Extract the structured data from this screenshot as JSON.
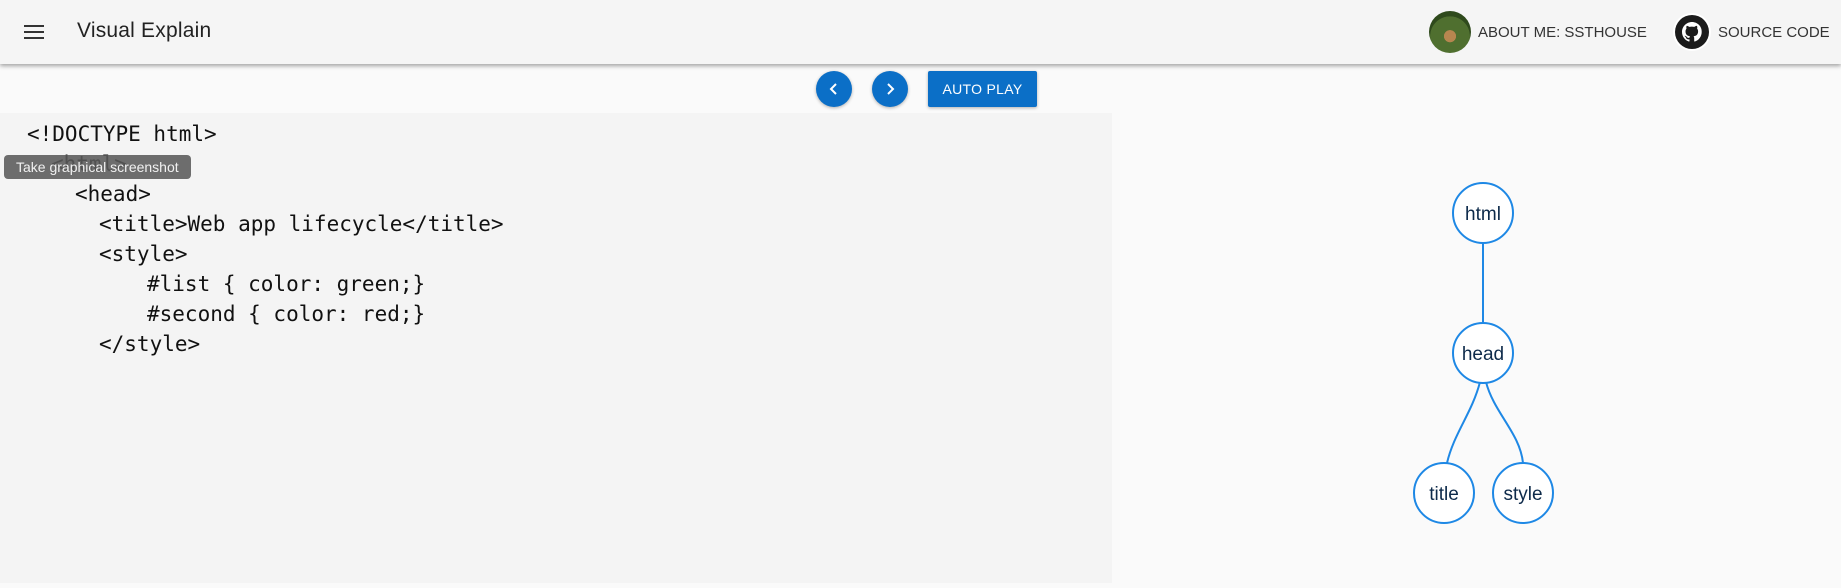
{
  "header": {
    "title": "Visual Explain",
    "about_label": "ABOUT ME: SSTHOUSE",
    "source_label": "SOURCE CODE"
  },
  "controls": {
    "autoplay_label": "AUTO PLAY"
  },
  "tooltip": "Take graphical screenshot",
  "code_lines": [
    "<!DOCTYPE html>",
    "<html>",
    "<head>",
    "<title>Web app lifecycle</title>",
    "<style>",
    "#list { color: green;}",
    "#second { color: red;}",
    "</style>"
  ],
  "tree": {
    "nodes": [
      "html",
      "head",
      "title",
      "style"
    ]
  },
  "colors": {
    "accent": "#0b6fc7",
    "tree_stroke": "#1e88e5",
    "tree_text": "#0d2a4a"
  }
}
